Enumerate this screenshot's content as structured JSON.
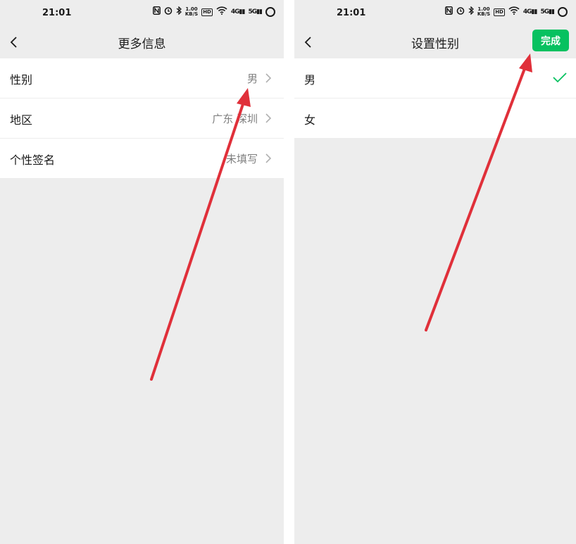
{
  "left": {
    "status": {
      "time": "21:01",
      "speed_top": "1.00",
      "speed_bottom": "KB/S",
      "hd": "HD",
      "signal_a": "4G",
      "signal_b": "5G"
    },
    "nav": {
      "title": "更多信息"
    },
    "rows": [
      {
        "label": "性别",
        "value": "男"
      },
      {
        "label": "地区",
        "value": "广东 深圳"
      },
      {
        "label": "个性签名",
        "value": "未填写"
      }
    ]
  },
  "right": {
    "status": {
      "time": "21:01",
      "speed_top": "1.00",
      "speed_bottom": "KB/S",
      "hd": "HD",
      "signal_a": "4G",
      "signal_b": "5G"
    },
    "nav": {
      "title": "设置性别",
      "done_label": "完成"
    },
    "options": [
      {
        "label": "男",
        "selected": true
      },
      {
        "label": "女",
        "selected": false
      }
    ]
  },
  "colors": {
    "accent_green": "#07c160",
    "arrow_red": "#e0303a",
    "background": "#ededed"
  },
  "icons": [
    "back-arrow-icon",
    "chevron-right-icon",
    "checkmark-icon",
    "nfc-icon",
    "alarm-icon",
    "bluetooth-icon",
    "wifi-icon",
    "signal-icon",
    "battery-ring-icon"
  ]
}
